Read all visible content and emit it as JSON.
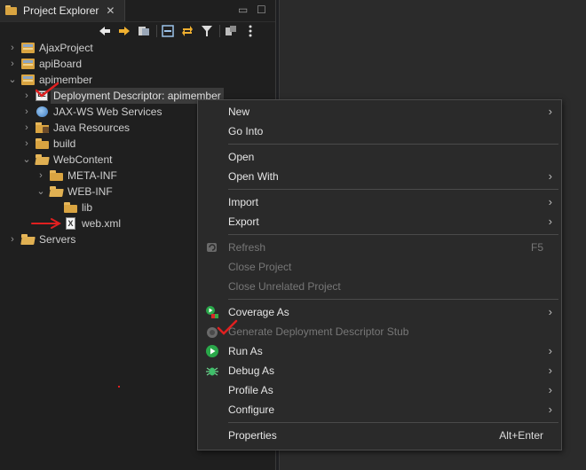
{
  "panel": {
    "tab_label": "Project Explorer",
    "close_glyph": "✕",
    "minimize_glyph": "▭",
    "maximize_glyph": "☐"
  },
  "toolbar": {
    "icons": [
      "arrow-left-icon",
      "arrow-right-icon",
      "link-icon",
      "collapse-all-icon",
      "sync-icon",
      "filter-icon",
      "working-set-icon",
      "view-menu-icon"
    ]
  },
  "tree": {
    "items": [
      {
        "label": "AjaxProject",
        "type": "project",
        "expanded": false
      },
      {
        "label": "apiBoard",
        "type": "project",
        "expanded": false
      },
      {
        "label": "apimember",
        "type": "project",
        "expanded": true
      },
      {
        "label": "Deployment Descriptor: apimember",
        "type": "descriptor",
        "expanded": false,
        "selected": true
      },
      {
        "label": "JAX-WS Web Services",
        "type": "webservice",
        "expanded": false
      },
      {
        "label": "Java Resources",
        "type": "java",
        "expanded": false
      },
      {
        "label": "build",
        "type": "folder",
        "expanded": false
      },
      {
        "label": "WebContent",
        "type": "folder-open",
        "expanded": true
      },
      {
        "label": "META-INF",
        "type": "folder",
        "expanded": false
      },
      {
        "label": "WEB-INF",
        "type": "folder-open",
        "expanded": true
      },
      {
        "label": "lib",
        "type": "folder",
        "expanded": false
      },
      {
        "label": "web.xml",
        "type": "xml",
        "expanded": false
      },
      {
        "label": "Servers",
        "type": "folder-open",
        "expanded": false
      }
    ]
  },
  "context_menu": {
    "items": [
      {
        "label": "New",
        "submenu": true,
        "disabled": false
      },
      {
        "label": "Go Into",
        "submenu": false,
        "disabled": false
      },
      {
        "separator": true
      },
      {
        "label": "Open",
        "submenu": false,
        "disabled": false
      },
      {
        "label": "Open With",
        "submenu": true,
        "disabled": false
      },
      {
        "separator": true
      },
      {
        "label": "Import",
        "submenu": true,
        "disabled": false
      },
      {
        "label": "Export",
        "submenu": true,
        "disabled": false
      },
      {
        "separator": true
      },
      {
        "label": "Refresh",
        "accelerator": "F5",
        "submenu": false,
        "disabled": true,
        "icon": "refresh-icon"
      },
      {
        "label": "Close Project",
        "submenu": false,
        "disabled": true
      },
      {
        "label": "Close Unrelated Project",
        "submenu": false,
        "disabled": true
      },
      {
        "separator": true
      },
      {
        "label": "Coverage As",
        "submenu": true,
        "disabled": false,
        "icon": "coverage-icon"
      },
      {
        "label": "Generate Deployment Descriptor Stub",
        "submenu": false,
        "disabled": true,
        "icon": "generate-stub-icon"
      },
      {
        "label": "Run As",
        "submenu": true,
        "disabled": false,
        "icon": "run-icon"
      },
      {
        "label": "Debug As",
        "submenu": true,
        "disabled": false,
        "icon": "debug-icon"
      },
      {
        "label": "Profile As",
        "submenu": true,
        "disabled": false
      },
      {
        "label": "Configure",
        "submenu": true,
        "disabled": false
      },
      {
        "separator": true
      },
      {
        "label": "Properties",
        "accelerator": "Alt+Enter",
        "submenu": false,
        "disabled": false
      }
    ],
    "submenu_glyph": "›"
  },
  "colors": {
    "background": "#1f1f1f",
    "menu_bg": "#2a2a2a",
    "annotation_red": "#e02020"
  }
}
